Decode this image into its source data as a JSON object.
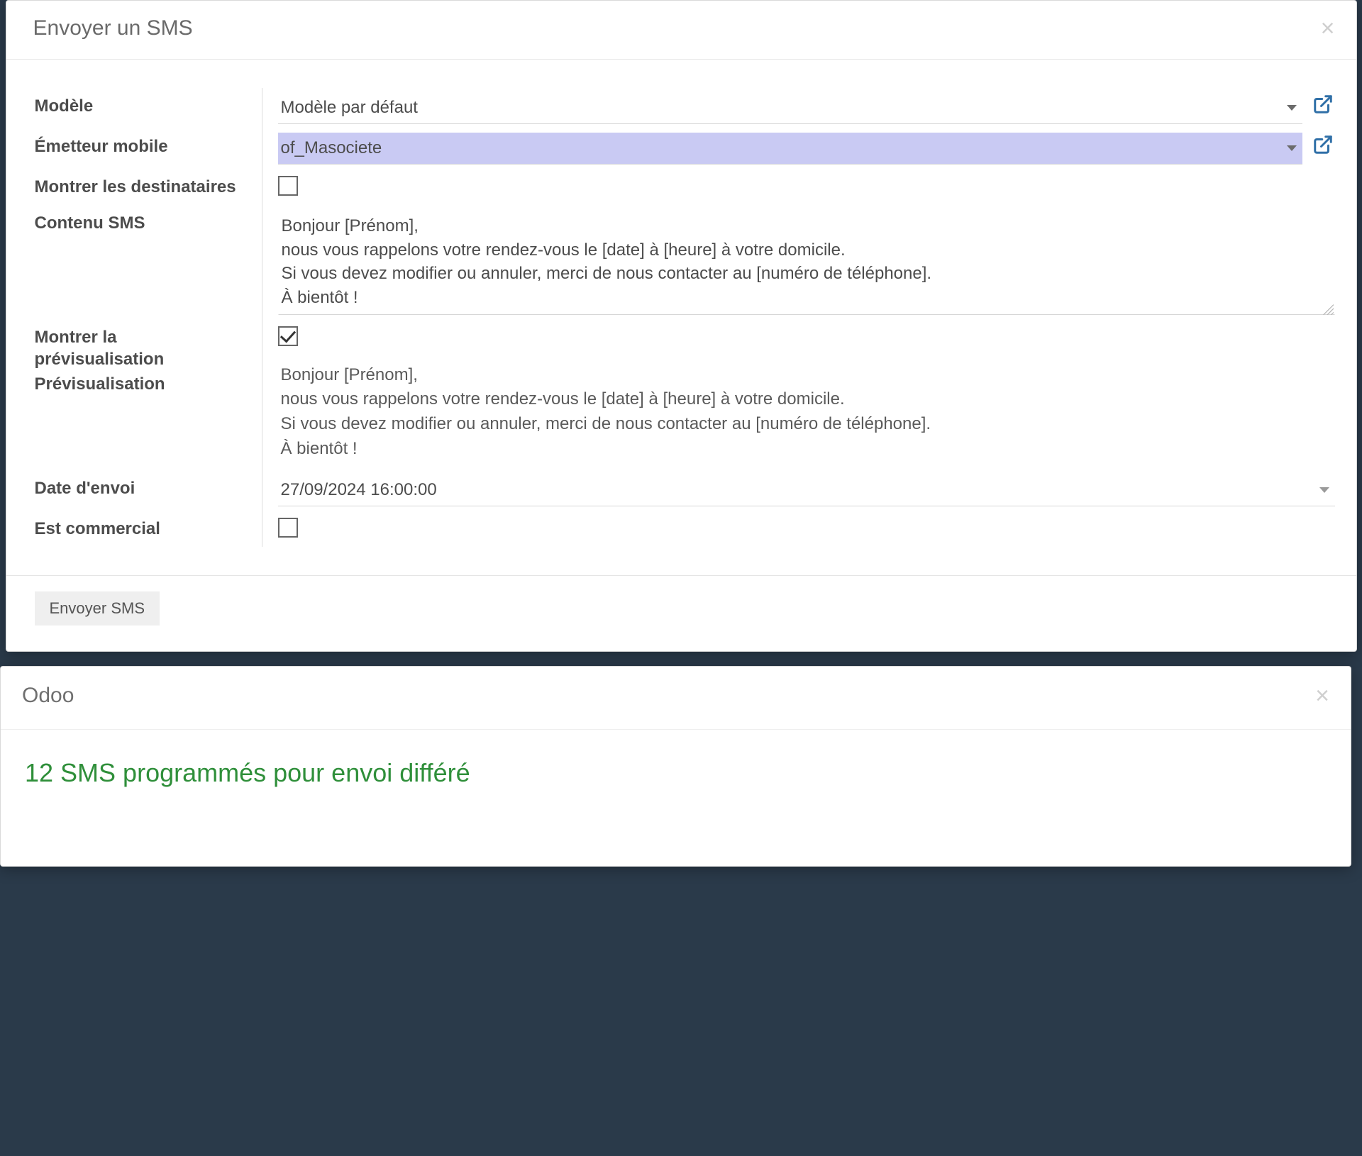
{
  "dialog1": {
    "title": "Envoyer un SMS",
    "labels": {
      "model": "Modèle",
      "sender": "Émetteur mobile",
      "show_recipients": "Montrer les destinataires",
      "content": "Contenu SMS",
      "show_preview": "Montrer la prévisualisation",
      "preview": "Prévisualisation",
      "send_date": "Date d'envoi",
      "is_commercial": "Est commercial"
    },
    "fields": {
      "model": "Modèle par défaut",
      "sender": "of_Masociete",
      "show_recipients": false,
      "content": "Bonjour [Prénom],\nnous vous rappelons votre rendez-vous le [date] à [heure] à votre domicile.\nSi vous devez modifier ou annuler, merci de nous contacter au [numéro de téléphone].\nÀ bientôt !",
      "show_preview": true,
      "preview_text": "Bonjour [Prénom],\nnous vous rappelons votre rendez-vous le [date] à [heure] à votre domicile.\nSi vous devez modifier ou annuler, merci de nous contacter au [numéro de téléphone].\nÀ bientôt !",
      "send_date": "27/09/2024 16:00:00",
      "is_commercial": false
    },
    "footer": {
      "submit": "Envoyer SMS"
    }
  },
  "dialog2": {
    "title": "Odoo",
    "message": "12 SMS programmés pour envoi différé"
  }
}
